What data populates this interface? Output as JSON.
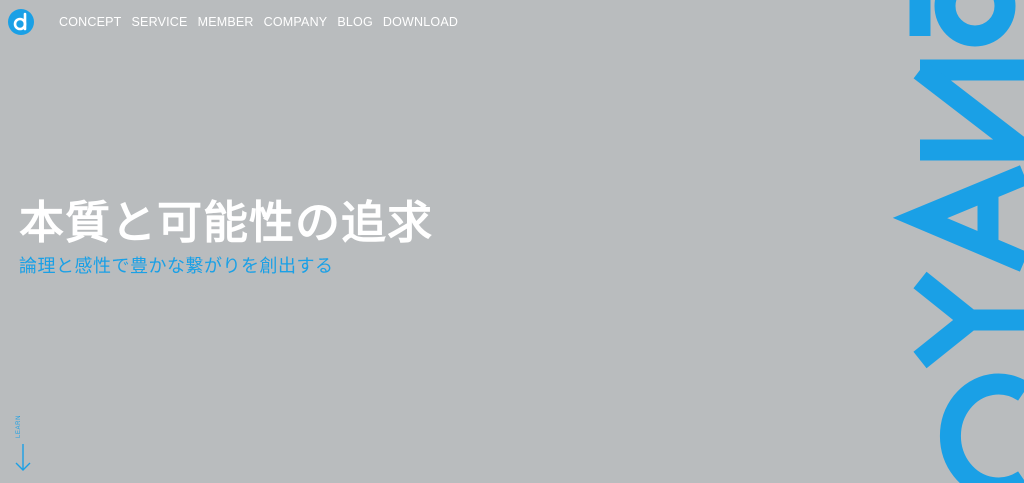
{
  "header": {
    "logo_icon": "d-circle-logo-icon",
    "nav": [
      {
        "label": "CONCEPT"
      },
      {
        "label": "SERVICE"
      },
      {
        "label": "MEMBER"
      },
      {
        "label": "COMPANY"
      },
      {
        "label": "BLOG"
      },
      {
        "label": "DOWNLOAD"
      }
    ]
  },
  "hero": {
    "headline": "本質と可能性の追求",
    "subheadline": "論理と感性で豊かな繋がりを創出する"
  },
  "learn": {
    "label": "LEARN",
    "icon": "arrow-down-icon"
  },
  "brand": {
    "wordmark": "CYANd",
    "color": "#1aa0e6"
  },
  "colors": {
    "background": "#b9bcbe",
    "accent": "#1aa0e6",
    "text": "#ffffff"
  }
}
